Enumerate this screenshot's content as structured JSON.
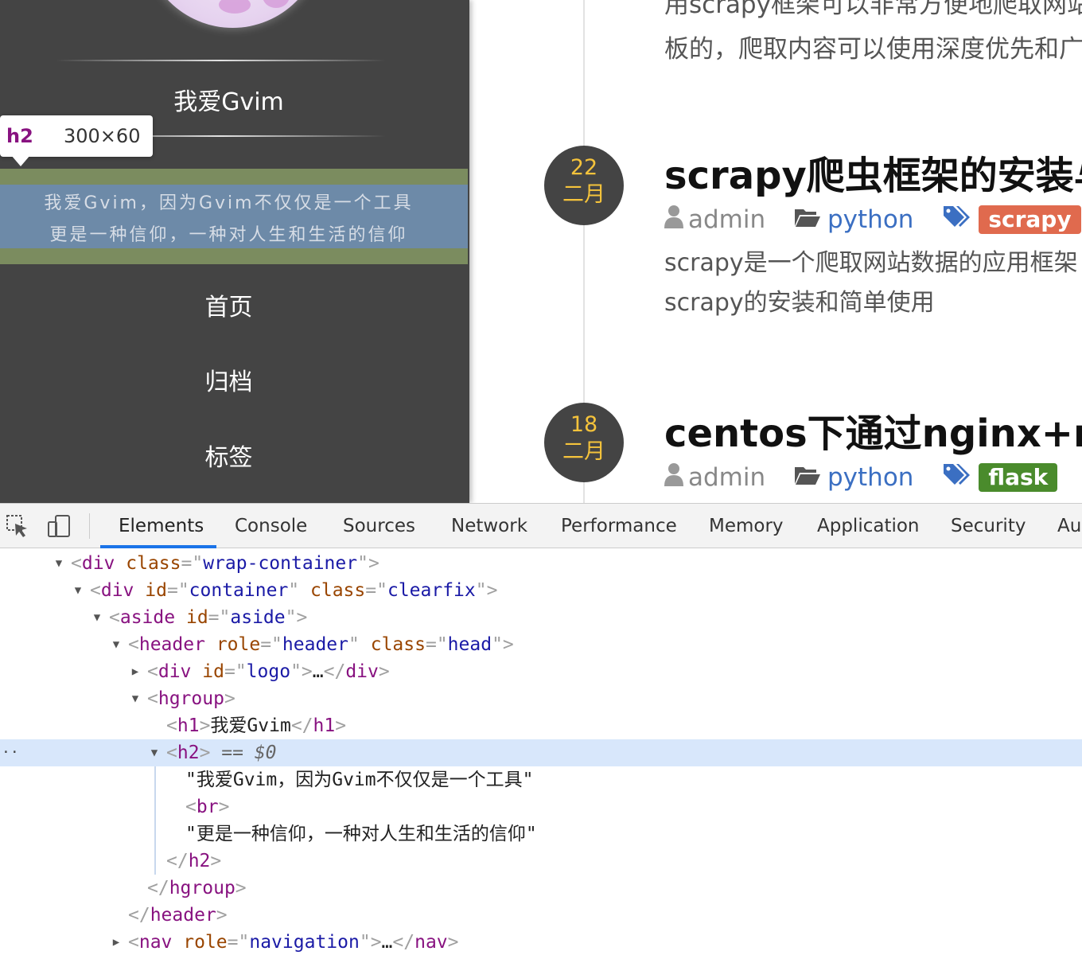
{
  "page": {
    "site_title": "我爱Gvim",
    "subtitle_line1": "我爱Gvim，因为Gvim不仅仅是一个工具",
    "subtitle_line2": "更是一种信仰，一种对人生和生活的信仰",
    "inspect_tooltip": {
      "tag": "h2",
      "dims": "300×60"
    },
    "nav": [
      "首页",
      "归档",
      "标签"
    ],
    "snippet_line1": "用scrapy框架可以非常方便地爬取网站",
    "snippet_line2": "板的，爬取内容可以使用深度优先和广",
    "posts": [
      {
        "day": "22",
        "month": "二月",
        "title": "scrapy爬虫框架的安装与",
        "author": "admin",
        "category": "python",
        "tag": "scrapy",
        "tag_color": "#e06a4e",
        "desc_line1": "scrapy是一个爬取网站数据的应用框架",
        "desc_line2": "scrapy的安装和简单使用"
      },
      {
        "day": "18",
        "month": "二月",
        "title": "centos下通过nginx+re",
        "author": "admin",
        "category": "python",
        "tag": "flask",
        "tag_color": "#4a8b2c"
      }
    ]
  },
  "devtools": {
    "tabs": [
      "Elements",
      "Console",
      "Sources",
      "Network",
      "Performance",
      "Memory",
      "Application",
      "Security",
      "Au"
    ],
    "active_tab": "Elements",
    "icons": [
      "inspect-element-icon",
      "device-toolbar-icon"
    ],
    "dom": {
      "l1": {
        "tag": "div",
        "attr1": "class",
        "val1": "wrap-container"
      },
      "l2": {
        "tag": "div",
        "attr1": "id",
        "val1": "container",
        "attr2": "class",
        "val2": "clearfix"
      },
      "l3": {
        "tag": "aside",
        "attr1": "id",
        "val1": "aside"
      },
      "l4": {
        "tag": "header",
        "attr1": "role",
        "val1": "header",
        "attr2": "class",
        "val2": "head"
      },
      "l5": {
        "tag": "div",
        "attr1": "id",
        "val1": "logo",
        "ellipsis": "…",
        "close": "div"
      },
      "l6": {
        "tag": "hgroup"
      },
      "l7": {
        "tag": "h1",
        "text": "我爱Gvim",
        "close": "h1"
      },
      "l8": {
        "tag": "h2",
        "marker": "== $0"
      },
      "l9": {
        "text": "\"我爱Gvim，因为Gvim不仅仅是一个工具\""
      },
      "l10": {
        "tag": "br"
      },
      "l11": {
        "text": "\"更是一种信仰，一种对人生和生活的信仰\""
      },
      "l12": {
        "close": "h2"
      },
      "l13": {
        "close": "hgroup"
      },
      "l14": {
        "close": "header"
      },
      "l15": {
        "tag": "nav",
        "attr1": "role",
        "val1": "navigation",
        "ellipsis": "…",
        "close": "nav"
      }
    }
  }
}
